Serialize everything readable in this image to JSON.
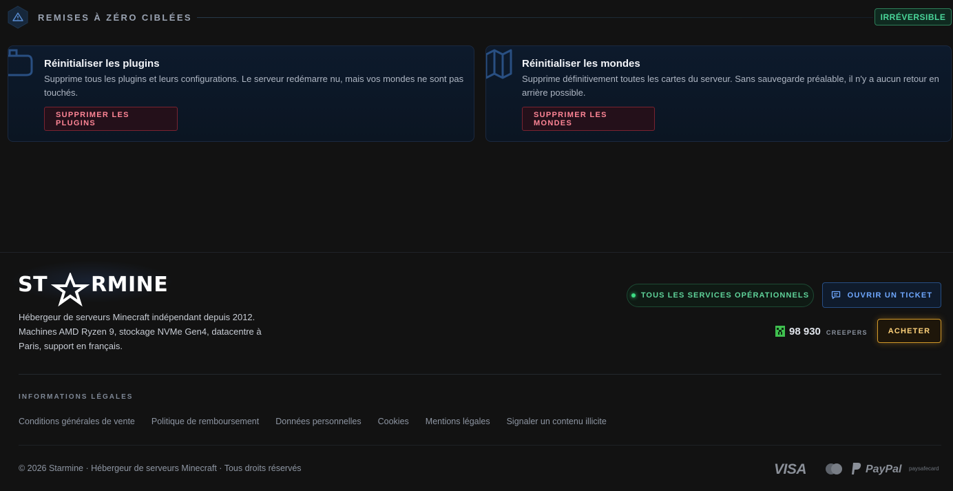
{
  "section": {
    "icon": "warning-icon",
    "title": "REMISES À ZÉRO CIBLÉES",
    "badge": "IRRÉVERSIBLE"
  },
  "cards": [
    {
      "icon": "plugin-icon",
      "title": "Réinitialiser les plugins",
      "description": "Supprime tous les plugins et leurs configurations. Le serveur redémarre nu, mais vos mondes ne sont pas touchés.",
      "button": "SUPPRIMER LES PLUGINS"
    },
    {
      "icon": "map-icon",
      "title": "Réinitialiser les mondes",
      "description": "Supprime définitivement toutes les cartes du serveur. Sans sauvegarde préalable, il n'y a aucun retour en arrière possible.",
      "button": "SUPPRIMER LES MONDES"
    }
  ],
  "footer": {
    "logo_pre": "ST",
    "logo_post": "RMINE",
    "description": "Hébergeur de serveurs Minecraft indépendant depuis 2012. Machines AMD Ryzen 9, stockage NVMe Gen4, datacentre à Paris, support en français.",
    "status": "TOUS LES SERVICES OPÉRATIONNELS",
    "ticket_button": "OUVRIR UN TICKET",
    "creepers_count": "98 930",
    "creepers_unit": "CREEPERS",
    "buy_button": "ACHETER",
    "legal_title": "INFORMATIONS LÉGALES",
    "legal_links": [
      "Conditions générales de vente",
      "Politique de remboursement",
      "Données personnelles",
      "Cookies",
      "Mentions légales",
      "Signaler un contenu illicite"
    ],
    "copyright": "© 2026 Starmine · Hébergeur de serveurs Minecraft · Tous droits réservés",
    "payments": {
      "visa": "VISA",
      "paypal": "PayPal",
      "paysafecard": "paysafecard"
    }
  },
  "colors": {
    "accent_green": "#4ad79a",
    "danger": "#ff8596",
    "ticket_blue": "#6fa8ff",
    "buy_gold": "#ffd27a"
  }
}
